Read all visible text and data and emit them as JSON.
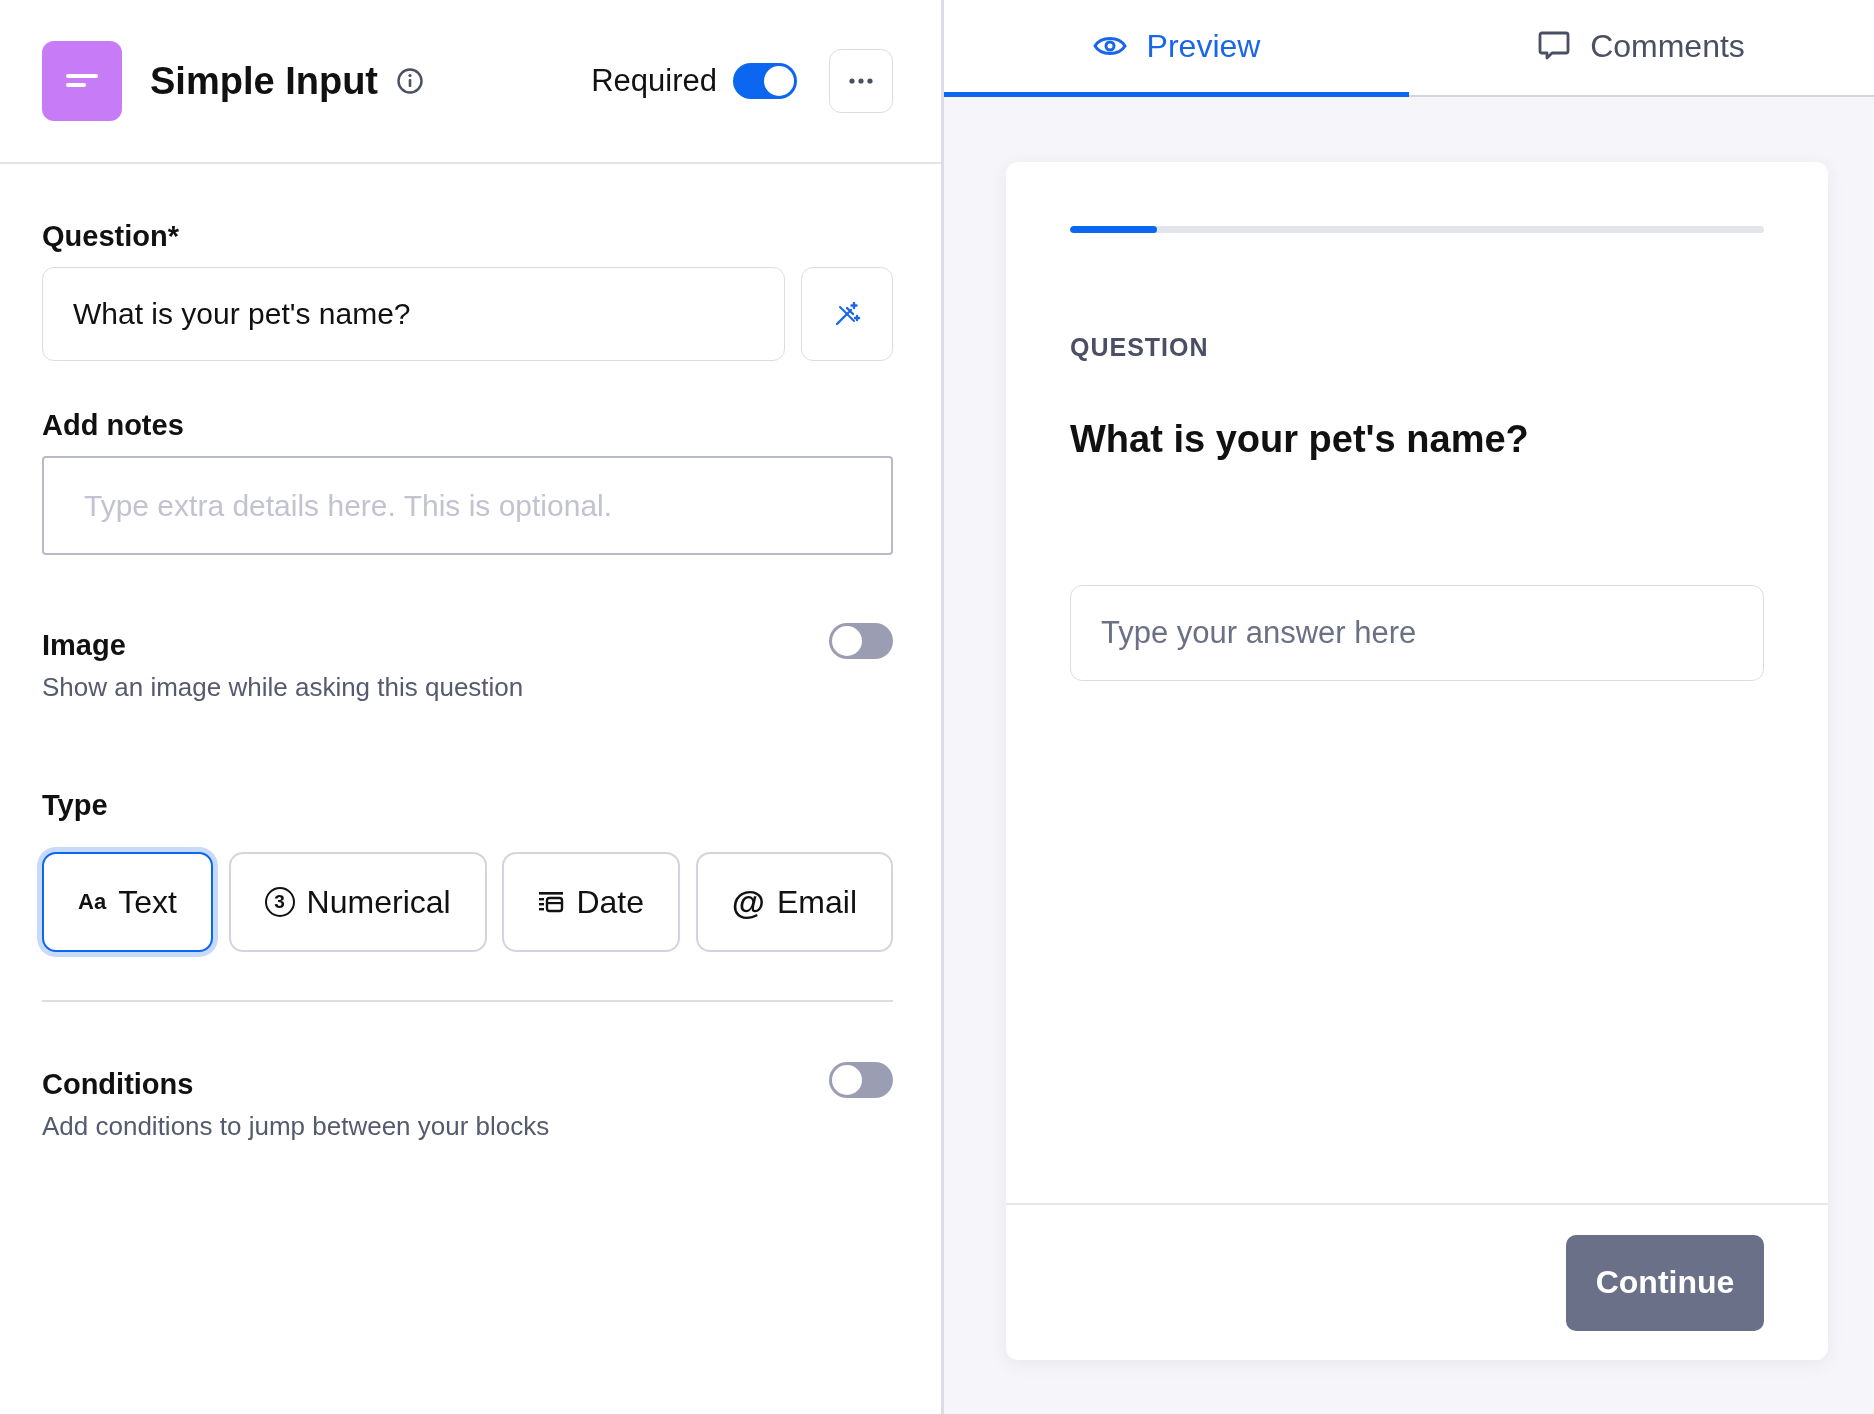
{
  "header": {
    "title": "Simple Input",
    "required_label": "Required",
    "required_on": true
  },
  "question": {
    "label": "Question*",
    "value": "What is your pet's name?"
  },
  "notes": {
    "label": "Add notes",
    "placeholder": "Type extra details here. This is optional."
  },
  "image": {
    "label": "Image",
    "description": "Show an image while asking this question",
    "on": false
  },
  "type": {
    "label": "Type",
    "options": [
      {
        "kind": "aa",
        "glyph": "Aa",
        "label": "Text",
        "selected": true
      },
      {
        "kind": "number",
        "glyph": "3",
        "label": "Numerical",
        "selected": false
      },
      {
        "kind": "date",
        "label": "Date",
        "selected": false
      },
      {
        "kind": "email",
        "glyph": "@",
        "label": "Email",
        "selected": false
      }
    ]
  },
  "conditions": {
    "label": "Conditions",
    "description": "Add conditions to jump between your blocks",
    "on": false
  },
  "tabs": [
    {
      "kind": "eye",
      "label": "Preview",
      "selected": true
    },
    {
      "kind": "comment",
      "label": "Comments",
      "selected": false
    }
  ],
  "preview": {
    "level": 0.125,
    "eyebrow": "QUESTION",
    "question": "What is your pet's name?",
    "answer_placeholder": "Type your answer here",
    "button": "Continue"
  }
}
